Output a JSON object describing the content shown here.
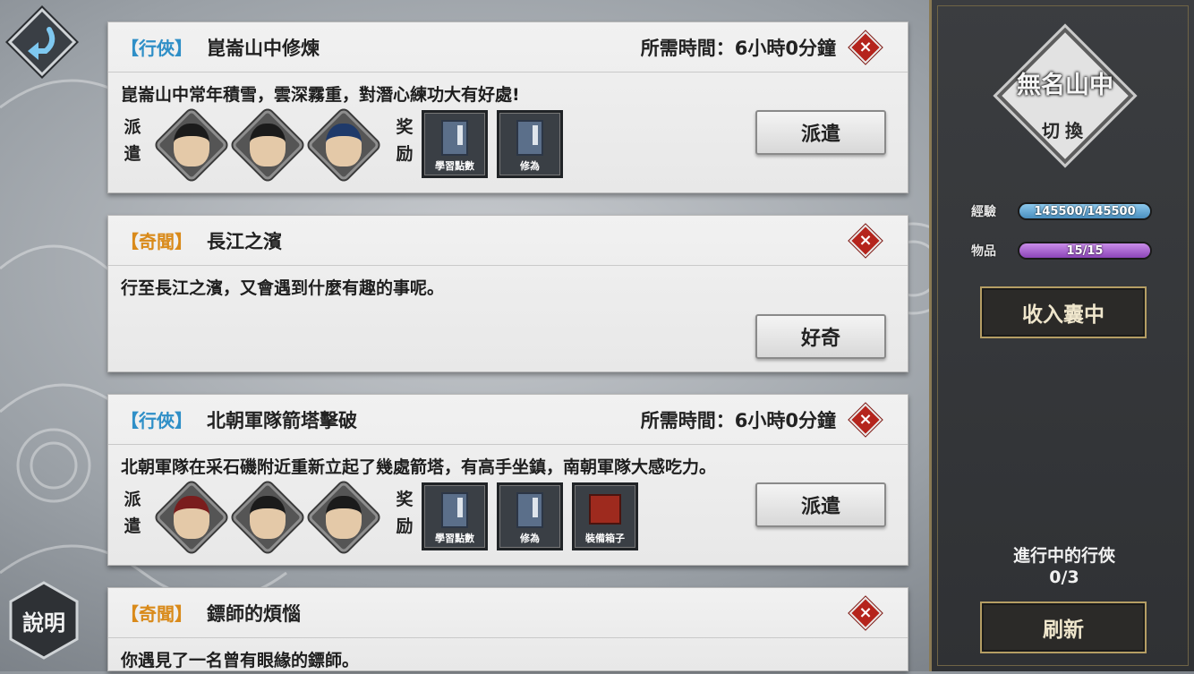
{
  "nav": {
    "back_icon": "back-arrow-icon",
    "help_label": "說明"
  },
  "quests": [
    {
      "tag": "【行俠】",
      "tag_color": "#2f8fc7",
      "title": "崑崙山中修煉",
      "time": "所需時間：6小時0分鐘",
      "desc": "崑崙山中常年積雪，雲深霧重，對潛心練功大有好處!",
      "dispatch_label": [
        "派",
        "遣"
      ],
      "reward_label": [
        "奖",
        "励"
      ],
      "rewards": [
        "學習點數",
        "修為"
      ],
      "action": "派遣"
    },
    {
      "tag": "【奇聞】",
      "tag_color": "#d98a1a",
      "title": "長江之濱",
      "desc": "行至長江之濱，又會遇到什麼有趣的事呢。",
      "action": "好奇"
    },
    {
      "tag": "【行俠】",
      "tag_color": "#2f8fc7",
      "title": "北朝軍隊箭塔擊破",
      "time": "所需時間：6小時0分鐘",
      "desc": "北朝軍隊在采石磯附近重新立起了幾處箭塔，有高手坐鎮，南朝軍隊大感吃力。",
      "dispatch_label": [
        "派",
        "遣"
      ],
      "reward_label": [
        "奖",
        "励"
      ],
      "rewards": [
        "學習點數",
        "修為",
        "裝備箱子"
      ],
      "action": "派遣"
    },
    {
      "tag": "【奇聞】",
      "tag_color": "#d98a1a",
      "title": "鏢師的煩惱",
      "desc": "你遇見了一名曾有眼緣的鏢師。"
    }
  ],
  "panel": {
    "location": "無名山中",
    "switch_label": "切換",
    "exp_label": "經驗",
    "exp_value": "145500/145500",
    "exp_fraction": 1.0,
    "items_label": "物品",
    "items_value": "15/15",
    "items_fraction": 1.0,
    "collect_button": "收入囊中",
    "ongoing_label": "進行中的行俠",
    "ongoing_value": "0/3",
    "refresh_button": "刷新"
  }
}
